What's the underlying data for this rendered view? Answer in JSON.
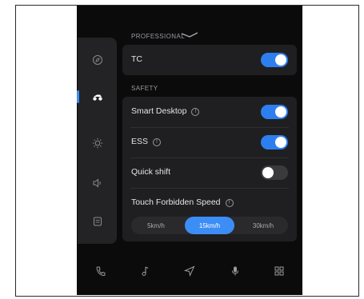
{
  "professional": {
    "section_title": "PROFESSIONAL",
    "items": [
      {
        "label": "TC",
        "on": true
      }
    ]
  },
  "safety": {
    "section_title": "SAFETY",
    "items": [
      {
        "label": "Smart Desktop",
        "info": true,
        "on": true
      },
      {
        "label": "ESS",
        "info": true,
        "on": true
      },
      {
        "label": "Quick shift",
        "info": false,
        "on": false
      }
    ],
    "speed_label": "Touch Forbidden Speed",
    "speed_options": [
      "5km/h",
      "15km/h",
      "30km/h"
    ],
    "speed_selected": "15km/h"
  },
  "sidebar": {
    "items": [
      {
        "icon": "compass-icon",
        "active": false
      },
      {
        "icon": "motorcycle-icon",
        "active": true
      },
      {
        "icon": "brightness-icon",
        "active": false
      },
      {
        "icon": "volume-icon",
        "active": false
      },
      {
        "icon": "document-icon",
        "active": false
      }
    ]
  },
  "bottom_nav": {
    "items": [
      "phone-icon",
      "music-icon",
      "navigation-icon",
      "microphone-icon",
      "grid-icon"
    ]
  },
  "colors": {
    "accent": "#3c8df5",
    "background": "#0b0b0c",
    "card": "#1f1f21"
  }
}
